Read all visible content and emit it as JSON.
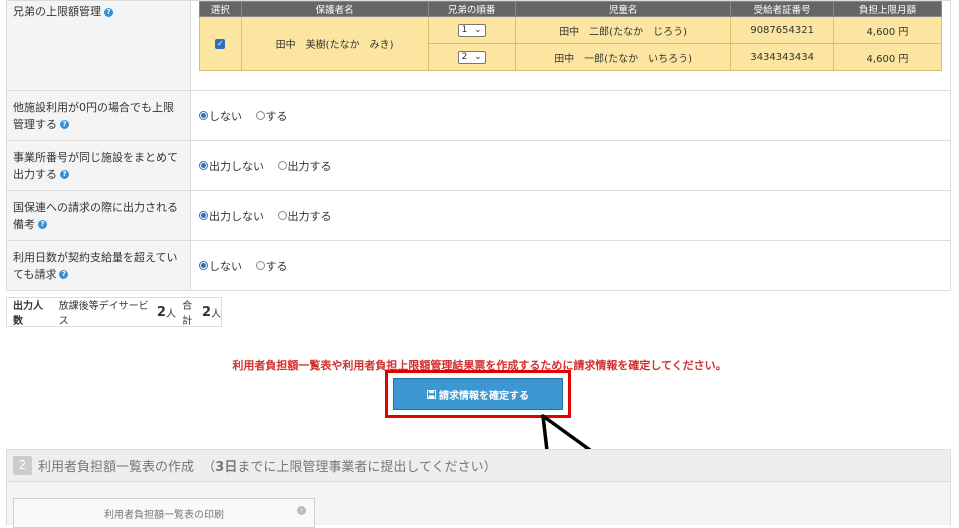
{
  "rows": [
    {
      "label": "兄弟の上限額管理"
    },
    {
      "label": "他施設利用が0円の場合でも上限管理する",
      "options": [
        "しない",
        "する"
      ],
      "selected": 0
    },
    {
      "label": "事業所番号が同じ施設をまとめて出力する",
      "options": [
        "出力しない",
        "出力する"
      ],
      "selected": 0
    },
    {
      "label": "国保連への請求の際に出力される備考",
      "options": [
        "出力しない",
        "出力する"
      ],
      "selected": 0
    },
    {
      "label": "利用日数が契約支給量を超えていても請求",
      "options": [
        "しない",
        "する"
      ],
      "selected": 0
    }
  ],
  "sibling_table": {
    "headers": [
      "選択",
      "保護者名",
      "兄弟の順番",
      "児童名",
      "受給者証番号",
      "負担上限月額"
    ],
    "guardian": "田中　美樹(たなか　みき)",
    "children": [
      {
        "order": "1",
        "name": "田中　二郎(たなか　じろう)",
        "cert": "9087654321",
        "limit": "4,600 円"
      },
      {
        "order": "2",
        "name": "田中　一郎(たなか　いちろう)",
        "cert": "3434343434",
        "limit": "4,600 円"
      }
    ]
  },
  "output_count": {
    "label": "出力人数",
    "service": "放課後等デイサービス",
    "service_count": "2",
    "unit": "人",
    "total_label": "合計",
    "total_count": "2"
  },
  "notice": "利用者負担額一覧表や利用者負担上限額管理結果票を作成するために請求情報を確定してください。",
  "confirm_button": "請求情報を確定する",
  "step2": {
    "number": "2",
    "title": "利用者負担額一覧表の作成",
    "note_prefix": "（",
    "note_bold": "3日",
    "note_rest": "までに上限管理事業者に提出してください）"
  },
  "print_button": "利用者負担額一覧表の印刷"
}
